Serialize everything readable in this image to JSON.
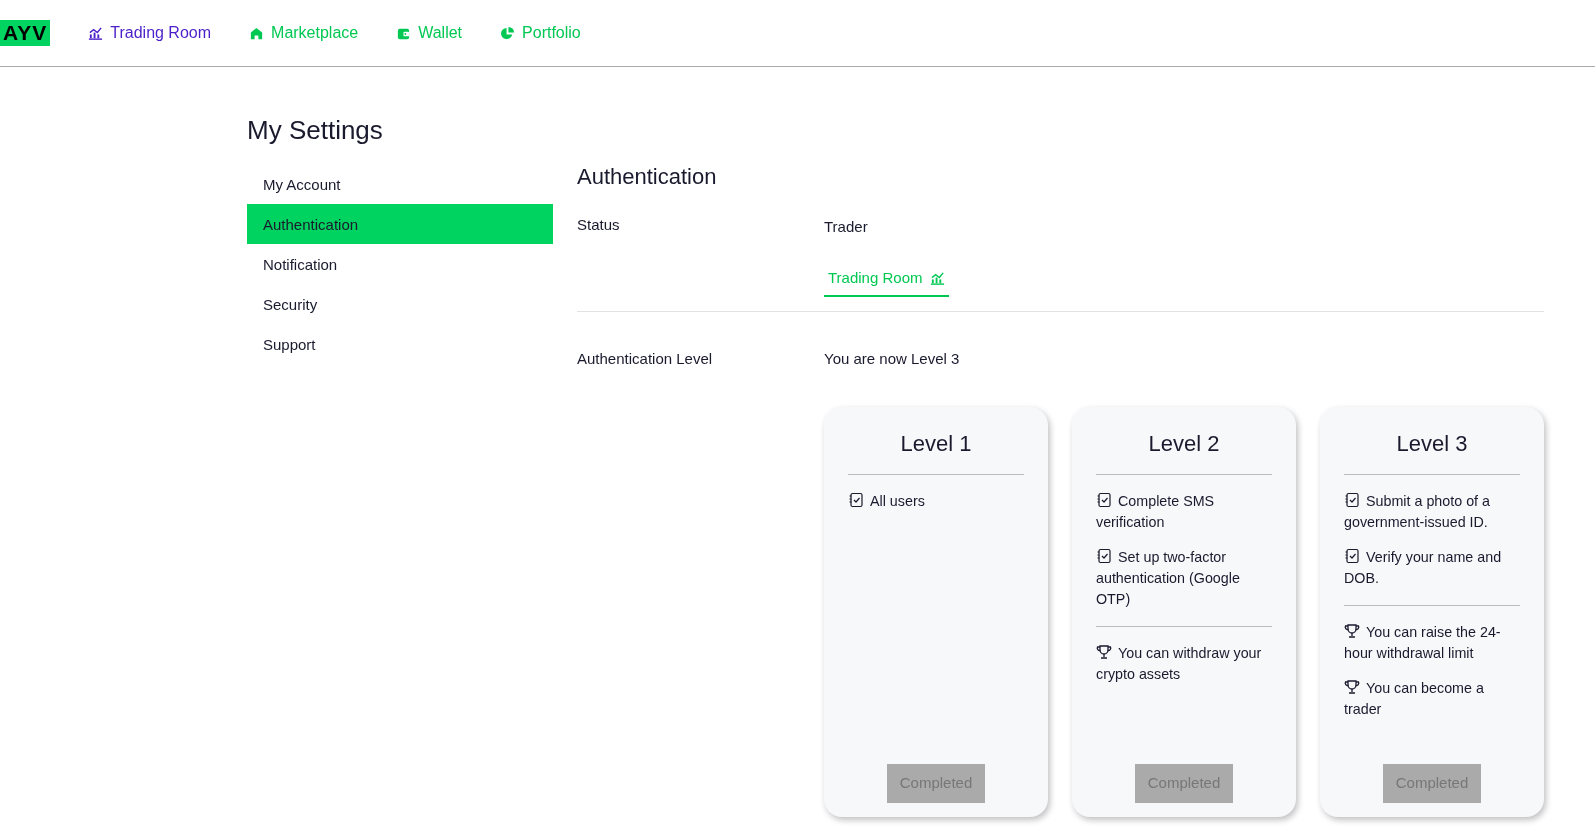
{
  "navbar": {
    "logo": "AYV",
    "items": [
      {
        "label": "Trading Room",
        "selected": true
      },
      {
        "label": "Marketplace",
        "selected": false
      },
      {
        "label": "Wallet",
        "selected": false
      },
      {
        "label": "Portfolio",
        "selected": false
      }
    ]
  },
  "page_title": "My Settings",
  "sidebar": {
    "items": [
      {
        "label": "My Account",
        "selected": false
      },
      {
        "label": "Authentication",
        "selected": true
      },
      {
        "label": "Notification",
        "selected": false
      },
      {
        "label": "Security",
        "selected": false
      },
      {
        "label": "Support",
        "selected": false
      }
    ]
  },
  "section": {
    "title": "Authentication",
    "status": {
      "label": "Status",
      "value": "Trader",
      "link": "Trading Room"
    },
    "level": {
      "label": "Authentication Level",
      "value": "You are now Level 3"
    },
    "cards": [
      {
        "title": "Level 1",
        "requirements": [
          "All users"
        ],
        "button": {
          "label": "Completed",
          "disabled": true
        }
      },
      {
        "title": "Level 2",
        "requirements": [
          "Complete SMS verification",
          "Set up two-factor authentication (Google OTP)"
        ],
        "benefits": [
          "You can withdraw your crypto assets"
        ],
        "button": {
          "label": "Completed",
          "disabled": true
        }
      },
      {
        "title": "Level 3",
        "requirements": [
          "Submit a photo of a government-issued ID.",
          "Verify your name and DOB."
        ],
        "benefits": [
          "You can raise the 24-hour withdrawal limit",
          "You can become a trader"
        ],
        "button": {
          "label": "Completed",
          "disabled": true
        }
      }
    ]
  }
}
